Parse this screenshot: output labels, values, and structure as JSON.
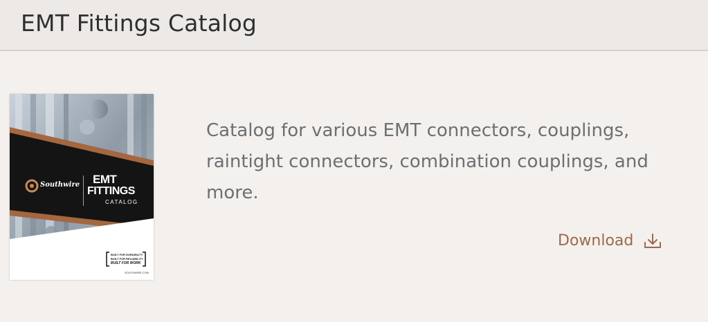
{
  "header": {
    "title": "EMT Fittings Catalog"
  },
  "card": {
    "description": "Catalog for various EMT connectors, couplings, raintight connectors, combination couplings, and more.",
    "download_label": "Download",
    "download_icon": "download-icon",
    "cover": {
      "brand": "Southwire",
      "title_line1": "EMT",
      "title_line2": "FITTINGS",
      "title_line3": "CATALOG",
      "tagline1": "BUILT FOR DURABILITY",
      "tagline2": "BUILT FOR RELIABILITY",
      "tagline3": "BUILT FOR WORK",
      "website": "SOUTHWIRE.COM"
    }
  },
  "colors": {
    "accent": "#9b6a4a",
    "header_bg": "#ece9e6",
    "page_bg": "#f4f0ed",
    "text": "#6c6f72"
  }
}
